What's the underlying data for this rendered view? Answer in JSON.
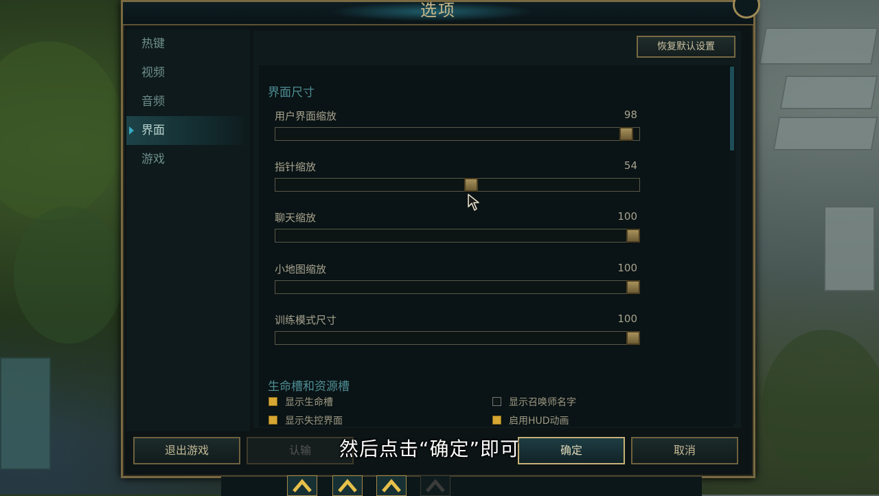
{
  "dialog": {
    "title": "选项"
  },
  "sidebar": {
    "items": [
      {
        "label": "热键",
        "active": false
      },
      {
        "label": "视频",
        "active": false
      },
      {
        "label": "音频",
        "active": false
      },
      {
        "label": "界面",
        "active": true
      },
      {
        "label": "游戏",
        "active": false
      }
    ]
  },
  "content": {
    "reset_label": "恢复默认设置",
    "interface_section": {
      "title": "界面尺寸",
      "sliders": [
        {
          "label": "用户界面缩放",
          "value": "98"
        },
        {
          "label": "指针缩放",
          "value": "54"
        },
        {
          "label": "聊天缩放",
          "value": "100"
        },
        {
          "label": "小地图缩放",
          "value": "100"
        },
        {
          "label": "训练模式尺寸",
          "value": "100"
        }
      ]
    },
    "health_section": {
      "title": "生命槽和资源槽",
      "checkboxes": [
        {
          "label": "显示生命槽",
          "checked": true
        },
        {
          "label": "显示召唤师名字",
          "checked": false
        },
        {
          "label": "显示失控界面",
          "checked": true
        },
        {
          "label": "启用HUD动画",
          "checked": true
        }
      ]
    }
  },
  "footer": {
    "quit_label": "退出游戏",
    "surrender_label": "认输",
    "ok_label": "确定",
    "cancel_label": "取消"
  },
  "subtitle": "然后点击“确定”即可",
  "colors": {
    "accent_gold": "#c8b276",
    "accent_teal": "#39a9c0",
    "checkbox_checked": "#d6a733"
  },
  "icons": {
    "cursor": "mouse-pointer-icon",
    "chevron": "chevron-up-icon"
  }
}
